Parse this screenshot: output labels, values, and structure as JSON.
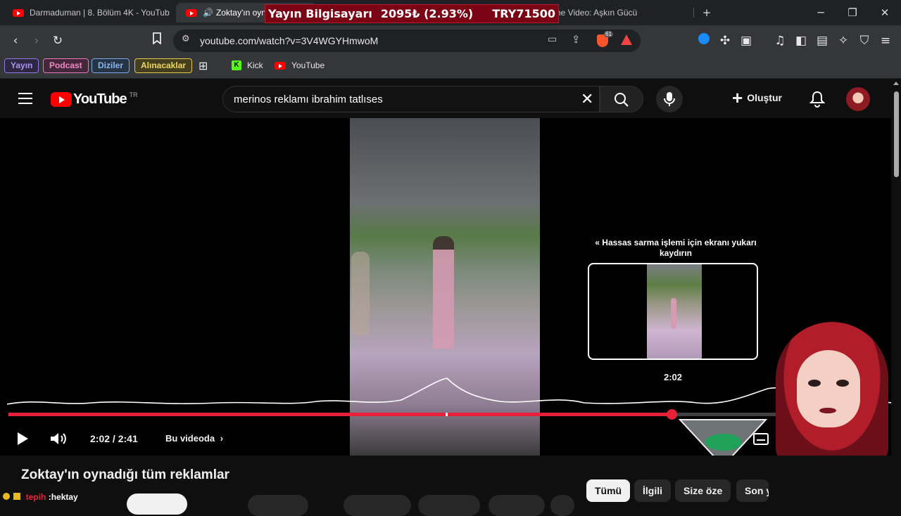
{
  "browser": {
    "tabs": [
      {
        "title": "Darmaduman | 8. Bölüm 4K - YouTub"
      },
      {
        "title": "Zoktay'ın oyna"
      },
      {
        "title": "ne Video: Aşkın Gücü"
      }
    ],
    "new_tab_icon": "plus-icon",
    "url": "youtube.com/watch?v=3V4WGYHmwoM",
    "brave_badge": "61"
  },
  "ticker": {
    "label": "Yayın Bilgisayarı",
    "change": "2095₺ (2.93%)",
    "price": "TRY71500"
  },
  "bookmarks": {
    "chips": [
      {
        "label": "Yayın",
        "color": "#8f7ae6"
      },
      {
        "label": "Podcast",
        "color": "#e67ab9"
      },
      {
        "label": "Diziler",
        "color": "#7aa9e6"
      },
      {
        "label": "Alınacaklar",
        "color": "#e6c94a"
      }
    ],
    "links": [
      {
        "label": "Kick"
      },
      {
        "label": "YouTube"
      }
    ]
  },
  "youtube": {
    "logo_text": "YouTube",
    "region": "TR",
    "search_query": "merinos reklamı ibrahim tatlıses",
    "create_label": "Oluştur"
  },
  "player": {
    "seek_hint": "Hassas sarma işlemi için ekranı yukarı kaydırın",
    "preview_time": "2:02",
    "current_time": "2:02",
    "time_separator": "/",
    "duration": "2:41",
    "in_video_label": "Bu videoda",
    "progress_fraction": 0.76
  },
  "video": {
    "title": "Zoktay'ın oynadığı tüm reklamlar"
  },
  "filters": [
    {
      "label": "Tümü",
      "active": true
    },
    {
      "label": "İlgili",
      "active": false
    },
    {
      "label": "Size öze",
      "active": false
    },
    {
      "label": "Son y",
      "active": false
    }
  ],
  "overlay": {
    "chat_user": "tepih",
    "chat_text": ":hektay"
  },
  "colors": {
    "accent_red": "#e8213a",
    "youtube_red": "#ff0000"
  }
}
